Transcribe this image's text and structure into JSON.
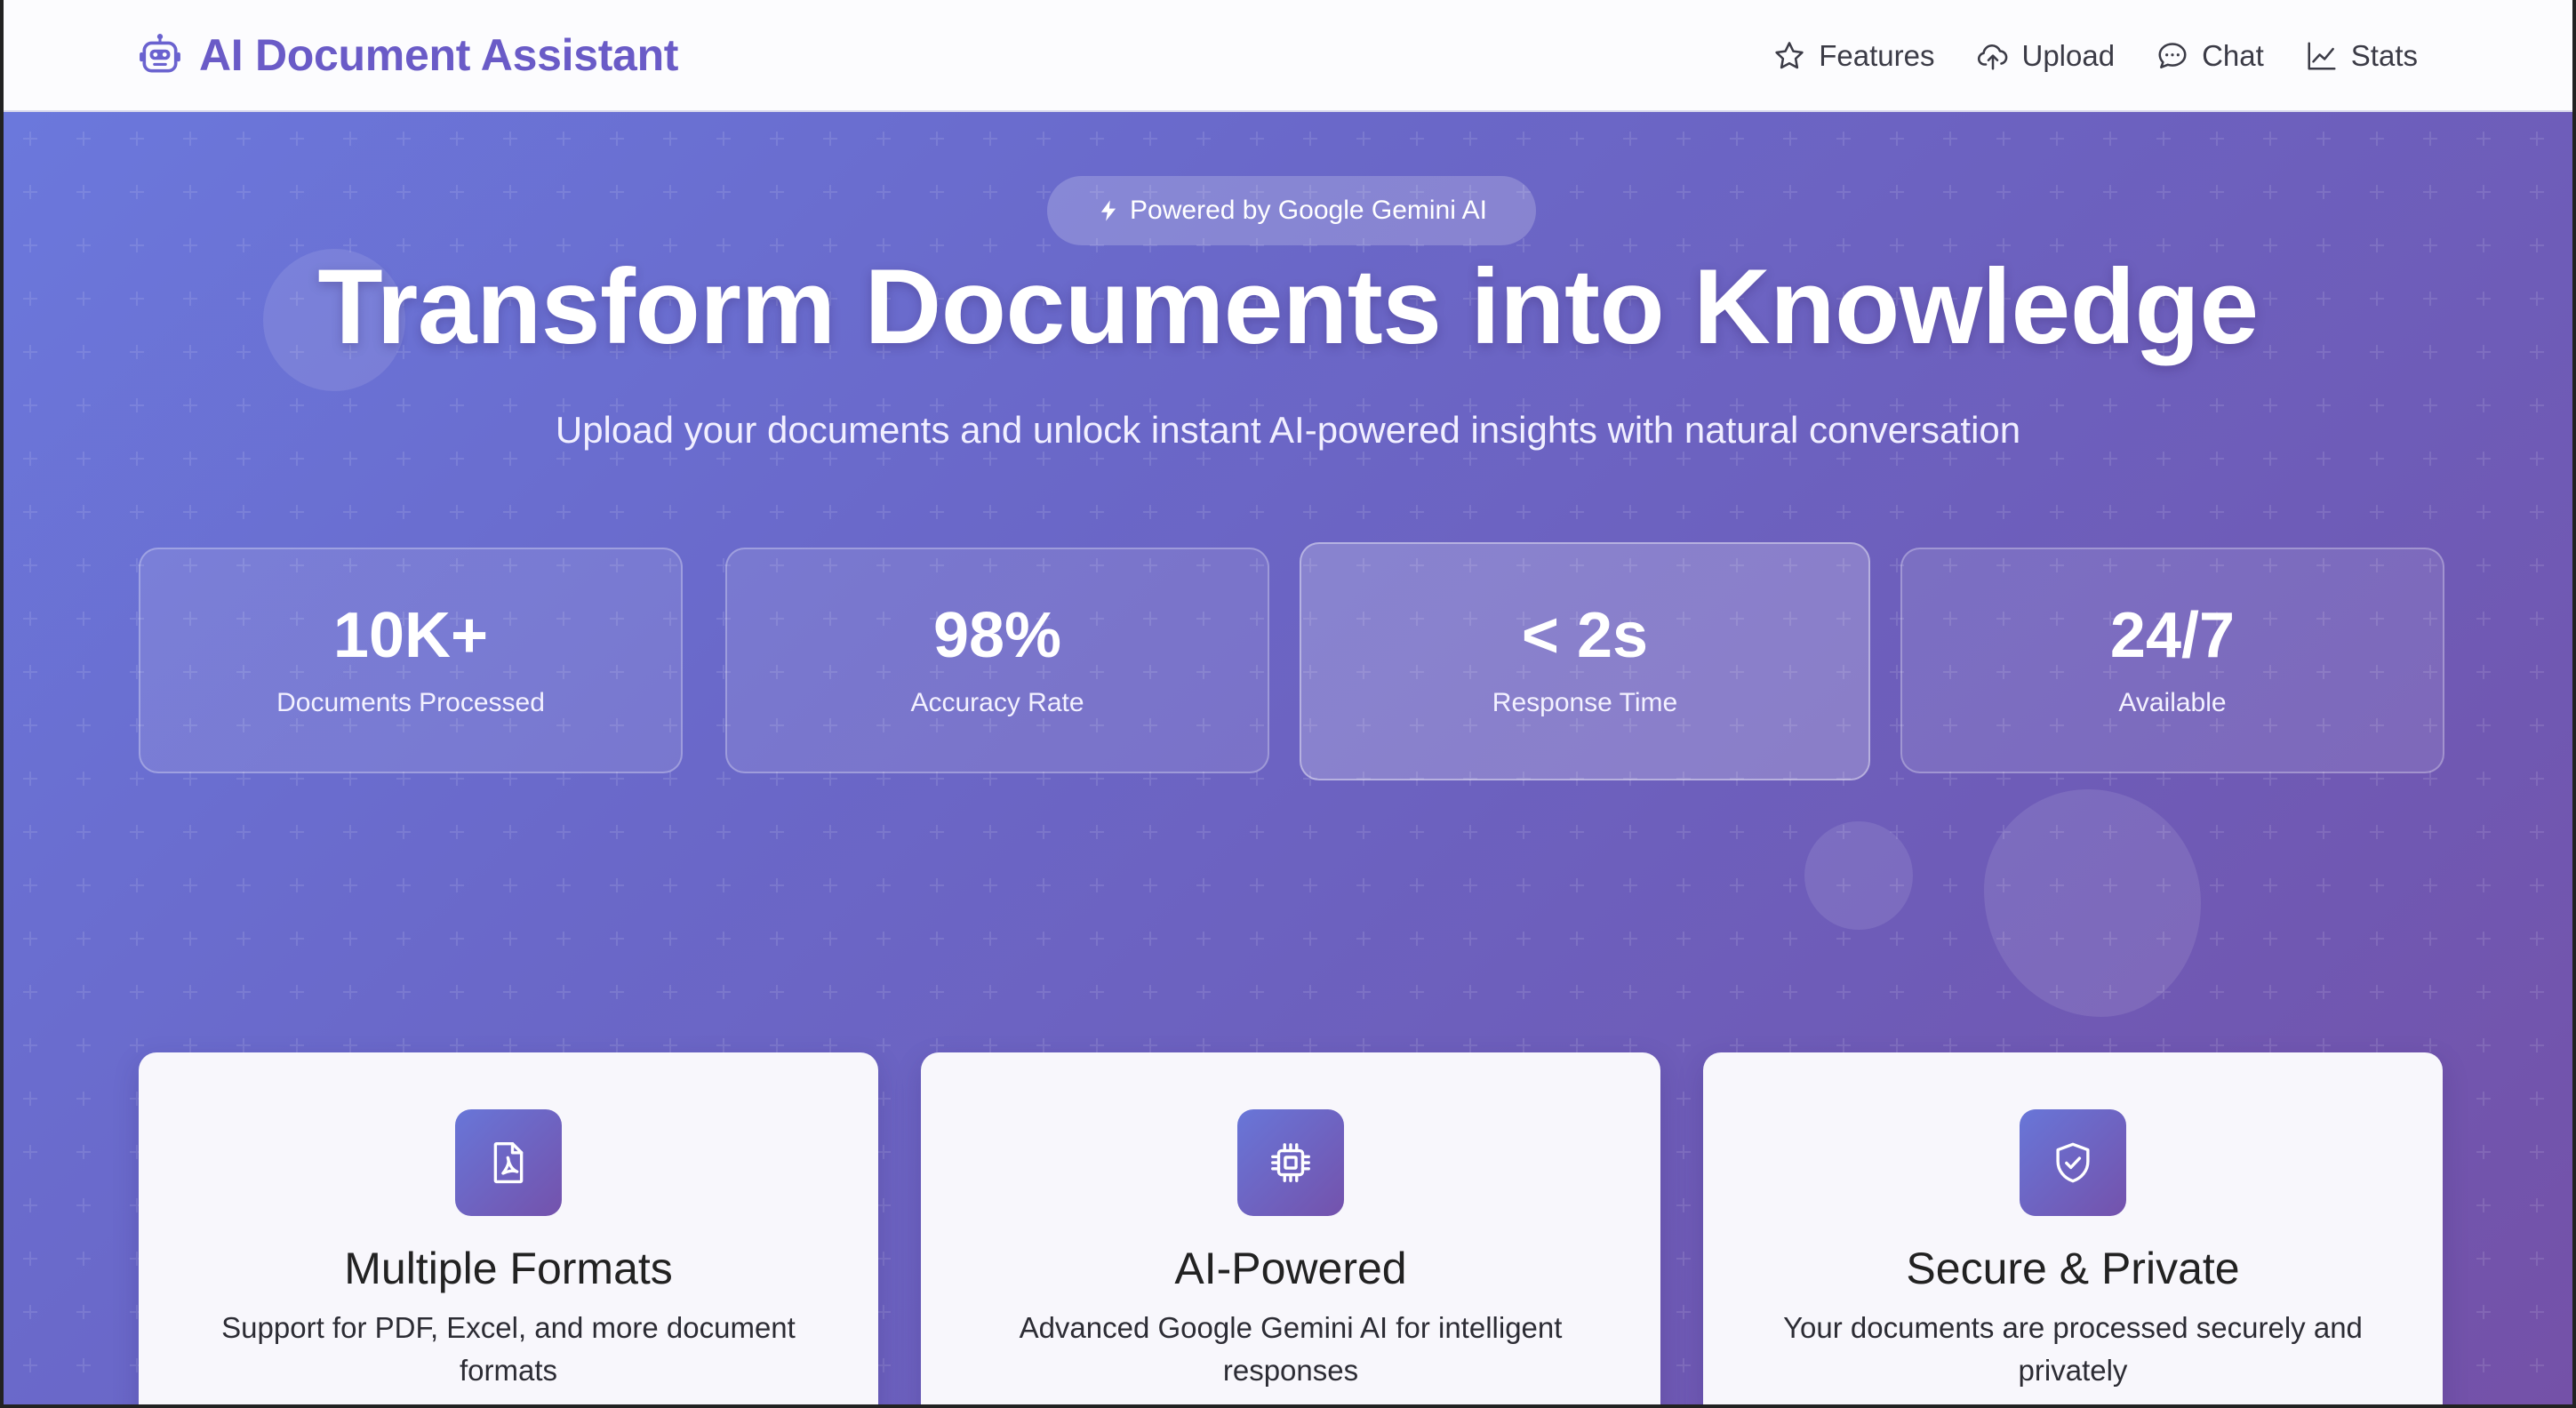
{
  "brand": {
    "title": "AI Document Assistant",
    "icon": "robot-icon"
  },
  "nav": [
    {
      "label": "Features",
      "icon": "star-icon"
    },
    {
      "label": "Upload",
      "icon": "cloud-upload-icon"
    },
    {
      "label": "Chat",
      "icon": "chat-bubble-icon"
    },
    {
      "label": "Stats",
      "icon": "line-chart-icon"
    }
  ],
  "hero": {
    "badge": "Powered by Google Gemini AI",
    "badge_icon": "lightning-icon",
    "title": "Transform Documents into Knowledge",
    "subtitle": "Upload your documents and unlock instant AI-powered insights with natural conversation"
  },
  "stats": [
    {
      "value": "10K+",
      "label": "Documents Processed"
    },
    {
      "value": "98%",
      "label": "Accuracy Rate"
    },
    {
      "value": "< 2s",
      "label": "Response Time"
    },
    {
      "value": "24/7",
      "label": "Available"
    }
  ],
  "features": [
    {
      "title": "Multiple Formats",
      "description": "Support for PDF, Excel, and more document formats",
      "icon": "pdf-file-icon"
    },
    {
      "title": "AI-Powered",
      "description": "Advanced Google Gemini AI for intelligent responses",
      "icon": "cpu-chip-icon"
    },
    {
      "title": "Secure & Private",
      "description": "Your documents are processed securely and privately",
      "icon": "shield-check-icon"
    }
  ],
  "colors": {
    "brand": "#6a5bc7",
    "hero_gradient_start": "#6b78dc",
    "hero_gradient_end": "#7451a8",
    "card_background": "#f8f7fc"
  }
}
